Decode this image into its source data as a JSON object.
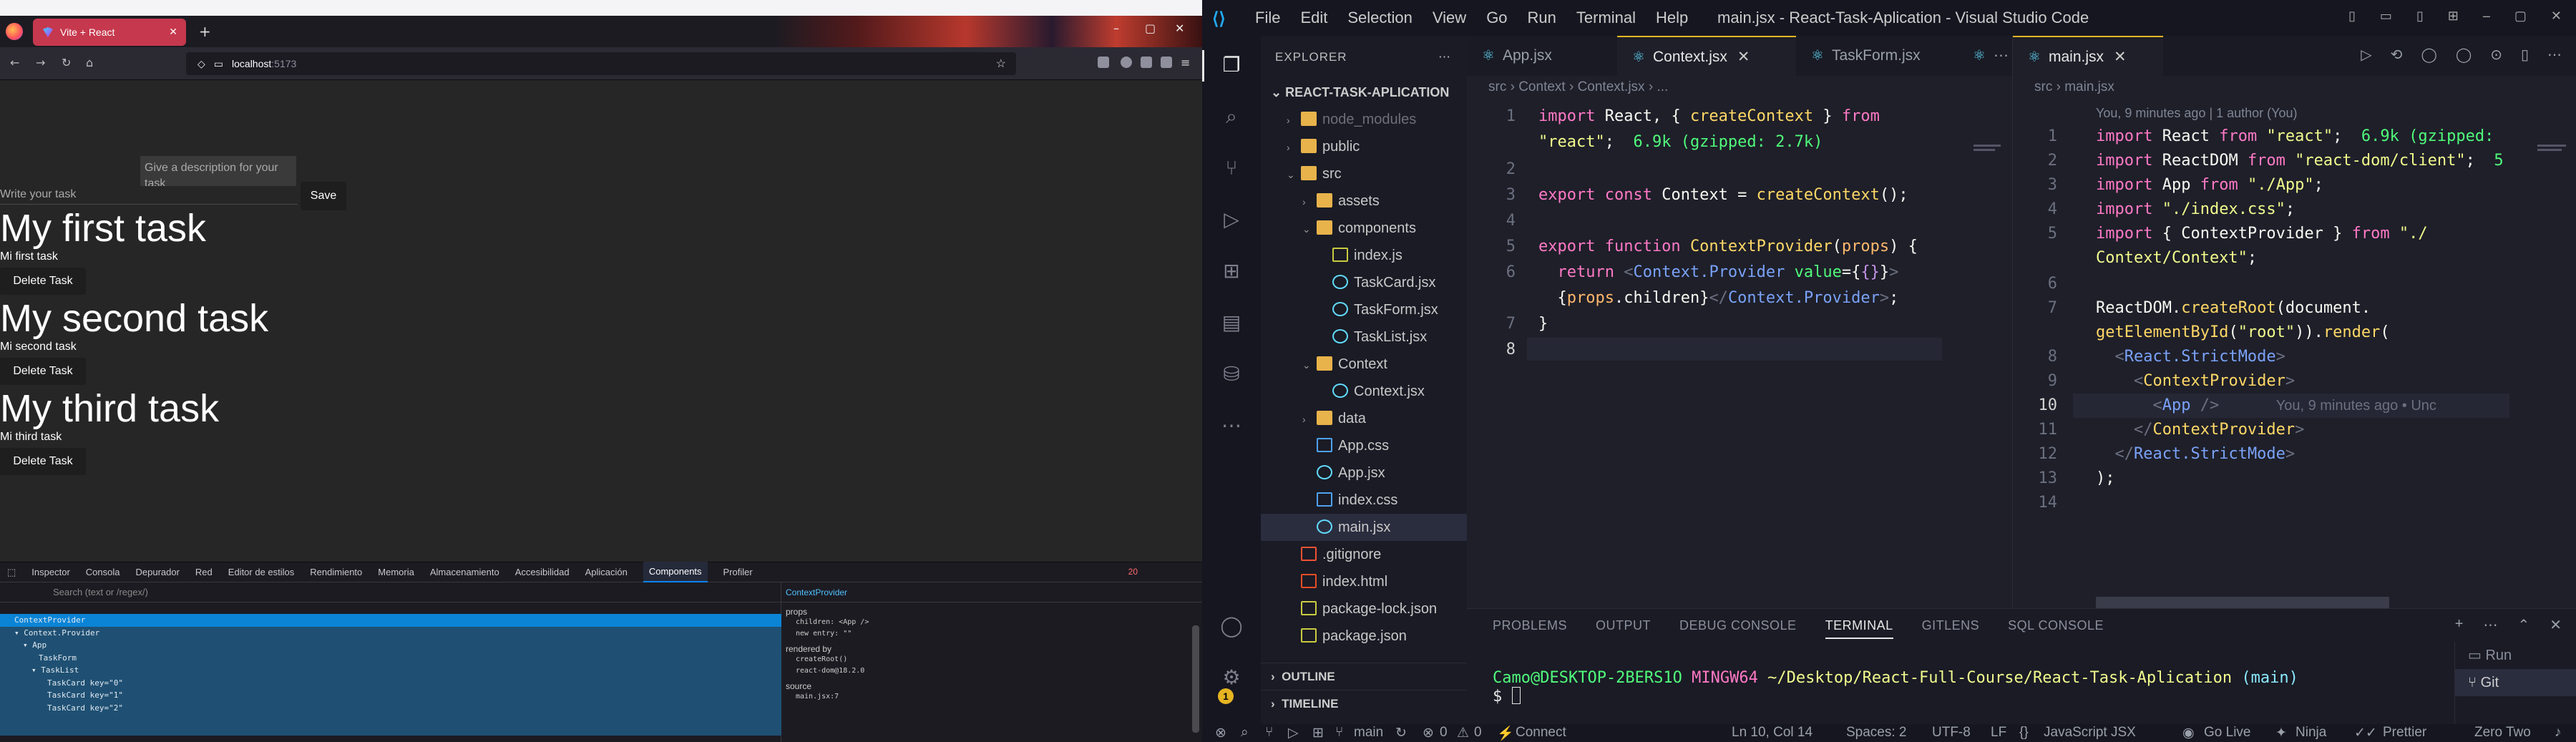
{
  "firefox": {
    "tab_title": "Vite + React",
    "url_host": "localhost",
    "url_port": ":5173",
    "app": {
      "description_placeholder": "Give a description for your task",
      "task_placeholder": "Write your task",
      "save_label": "Save",
      "delete_label": "Delete Task",
      "tasks": [
        {
          "title": "My first task",
          "description": "Mi first task"
        },
        {
          "title": "My second task",
          "description": "Mi second task"
        },
        {
          "title": "My third task",
          "description": "Mi third task"
        }
      ]
    },
    "devtools": {
      "tabs": [
        "Inspector",
        "Consola",
        "Depurador",
        "Red",
        "Editor de estilos",
        "Rendimiento",
        "Memoria",
        "Almacenamiento",
        "Accesibilidad",
        "Aplicación",
        "Components",
        "Profiler"
      ],
      "active_tab": "Components",
      "error_count": "20",
      "search_placeholder": "Search (text or /regex/)",
      "tree": [
        "ContextProvider",
        "▾ Context.Provider",
        "▾ App",
        "TaskForm",
        "▾ TaskList",
        "TaskCard key=\"0\"",
        "TaskCard key=\"1\"",
        "TaskCard key=\"2\""
      ],
      "selected": "ContextProvider",
      "props_label": "props",
      "props_lines": [
        "children: <App />",
        "new entry: \"\""
      ],
      "rendered_by_label": "rendered by",
      "rendered_by": [
        "createRoot()",
        "react-dom@18.2.0"
      ],
      "source_label": "source",
      "source": "main.jsx:7"
    }
  },
  "vscode": {
    "menu": [
      "File",
      "Edit",
      "Selection",
      "View",
      "Go",
      "Run",
      "Terminal",
      "Help"
    ],
    "window_title": "main.jsx - React-Task-Aplication - Visual Studio Code",
    "explorer": {
      "title": "EXPLORER",
      "project": "REACT-TASK-APLICATION",
      "items": [
        {
          "label": "node_modules",
          "depth": 1,
          "type": "folder",
          "dim": true
        },
        {
          "label": "public",
          "depth": 1,
          "type": "folder"
        },
        {
          "label": "src",
          "depth": 1,
          "type": "folder-open"
        },
        {
          "label": "assets",
          "depth": 2,
          "type": "folder"
        },
        {
          "label": "components",
          "depth": 2,
          "type": "folder-open"
        },
        {
          "label": "index.js",
          "depth": 3,
          "type": "js"
        },
        {
          "label": "TaskCard.jsx",
          "depth": 3,
          "type": "jsx"
        },
        {
          "label": "TaskForm.jsx",
          "depth": 3,
          "type": "jsx"
        },
        {
          "label": "TaskList.jsx",
          "depth": 3,
          "type": "jsx"
        },
        {
          "label": "Context",
          "depth": 2,
          "type": "folder-open"
        },
        {
          "label": "Context.jsx",
          "depth": 3,
          "type": "jsx"
        },
        {
          "label": "data",
          "depth": 2,
          "type": "folder"
        },
        {
          "label": "App.css",
          "depth": 2,
          "type": "css"
        },
        {
          "label": "App.jsx",
          "depth": 2,
          "type": "jsx"
        },
        {
          "label": "index.css",
          "depth": 2,
          "type": "css"
        },
        {
          "label": "main.jsx",
          "depth": 2,
          "type": "jsx",
          "selected": true
        },
        {
          "label": ".gitignore",
          "depth": 1,
          "type": "git"
        },
        {
          "label": "index.html",
          "depth": 1,
          "type": "html"
        },
        {
          "label": "package-lock.json",
          "depth": 1,
          "type": "json"
        },
        {
          "label": "package.json",
          "depth": 1,
          "type": "json"
        }
      ],
      "outline": "OUTLINE",
      "timeline": "TIMELINE"
    },
    "editor1": {
      "tabs": [
        "App.jsx",
        "Context.jsx",
        "TaskForm.jsx"
      ],
      "active": "Context.jsx",
      "breadcrumb": "src  ›  Context  ›  Context.jsx  ›  ..."
    },
    "editor2": {
      "tabs": [
        "main.jsx"
      ],
      "breadcrumb": "src  ›  main.jsx",
      "blame": "You, 9 minutes ago | 1 author (You)",
      "inline_blame": "You, 9 minutes ago • Unc"
    },
    "panel": {
      "tabs": [
        "PROBLEMS",
        "OUTPUT",
        "DEBUG CONSOLE",
        "TERMINAL",
        "GITLENS",
        "SQL CONSOLE"
      ],
      "active": "TERMINAL",
      "user": "Camo@DESKTOP-2BERS1O",
      "shell": "MINGW64",
      "path": "~/Desktop/React-Full-Course/React-Task-Aplication",
      "branch": "(main)",
      "prompt": "$",
      "run_items": [
        "Run",
        "Git"
      ]
    },
    "status": {
      "branch": "main",
      "errors": "0",
      "warnings": "0",
      "connect": "Connect",
      "position": "Ln 10, Col 14",
      "spaces": "Spaces: 2",
      "encoding": "UTF-8",
      "eol": "LF",
      "language": "JavaScript JSX",
      "golive": "Go Live",
      "ninja": "Ninja",
      "prettier": "Prettier",
      "theme": "Zero Two",
      "notif_count": "1"
    }
  }
}
